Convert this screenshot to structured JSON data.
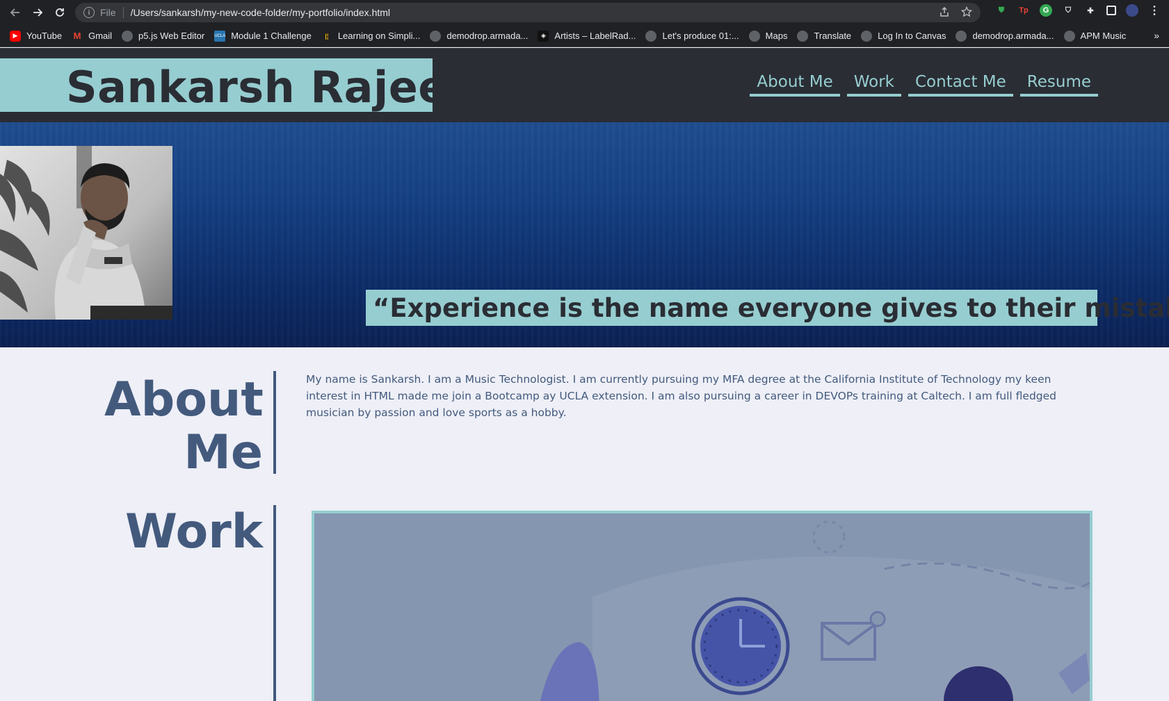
{
  "browser": {
    "url_scheme_label": "File",
    "url": "/Users/sankarsh/my-new-code-folder/my-portfolio/index.html",
    "bookmarks": [
      {
        "label": "YouTube",
        "icon": "youtube-icon"
      },
      {
        "label": "Gmail",
        "icon": "gmail-icon"
      },
      {
        "label": "p5.js Web Editor",
        "icon": "globe-icon"
      },
      {
        "label": "Module 1 Challenge",
        "icon": "ucla-icon"
      },
      {
        "label": "Learning on Simpli...",
        "icon": "simplilearn-icon"
      },
      {
        "label": "demodrop.armada...",
        "icon": "globe-icon"
      },
      {
        "label": "Artists – LabelRad...",
        "icon": "labelradar-icon"
      },
      {
        "label": "Let's produce 01:...",
        "icon": "globe-icon"
      },
      {
        "label": "Maps",
        "icon": "globe-icon"
      },
      {
        "label": "Translate",
        "icon": "globe-icon"
      },
      {
        "label": "Log In to Canvas",
        "icon": "globe-icon"
      },
      {
        "label": "demodrop.armada...",
        "icon": "globe-icon"
      },
      {
        "label": "APM Music",
        "icon": "globe-icon"
      }
    ],
    "more_label": "»"
  },
  "site": {
    "title": "Sankarsh Rajeev",
    "nav": [
      "About Me",
      "Work",
      "Contact Me",
      "Resume"
    ],
    "quote": "“Experience is the name everyone gives to their mistakes.”",
    "about": {
      "heading_line1": "About",
      "heading_line2": "Me",
      "body": "My name is Sankarsh. I am a Music Technologist. I am currently pursuing my MFA degree at the California Institute of Technology my keen interest in HTML made me join a Bootcamp ay UCLA extension. I am also pursuing a career in DEVOPs training at Caltech. I am full fledged musician by passion and love sports as a hobby."
    },
    "work": {
      "heading": "Work"
    }
  },
  "colors": {
    "accent": "#96cdd0",
    "header_bg": "#2a2d34",
    "section_text": "#435a7d",
    "page_bg": "#eeeff7"
  }
}
